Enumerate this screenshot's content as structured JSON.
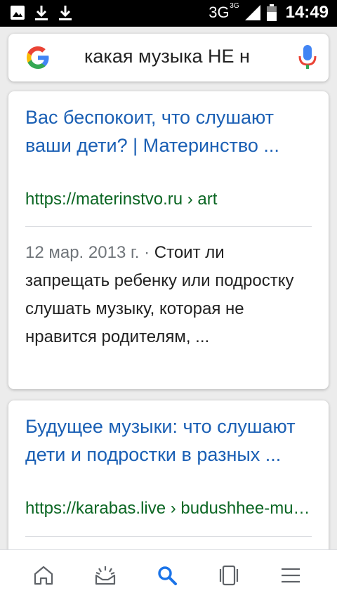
{
  "status_bar": {
    "network": "3G",
    "network_badge": "3G",
    "time": "14:49",
    "icons": [
      "image-icon",
      "download-icon",
      "download-icon",
      "signal-icon",
      "battery-icon"
    ]
  },
  "search": {
    "query": "какая музыка НЕ н",
    "icons": [
      "google-logo",
      "mic-icon"
    ]
  },
  "results": [
    {
      "title": "Вас беспокоит, что слушают ваши дети? | Материнство ...",
      "url": "https://materinstvo.ru › art",
      "date": "12 мар. 2013 г.",
      "separator": " · ",
      "snippet": "Стоит ли запрещать ребенку или подростку слушать музыку, которая не нравится родителям, ..."
    },
    {
      "title": "Будущее музыки: что слушают дети и подростки в разных ...",
      "url": "https://karabas.live › budushhee-muzyki"
    }
  ],
  "bottom_nav": {
    "items": [
      "home-icon",
      "discover-icon",
      "search-icon",
      "tabs-icon",
      "menu-icon"
    ],
    "active_color": "#1a73e8",
    "inactive_color": "#5f6368"
  },
  "colors": {
    "link": "#1a5fb4",
    "url": "#0b6623",
    "text": "#222222",
    "muted": "#70757a"
  }
}
